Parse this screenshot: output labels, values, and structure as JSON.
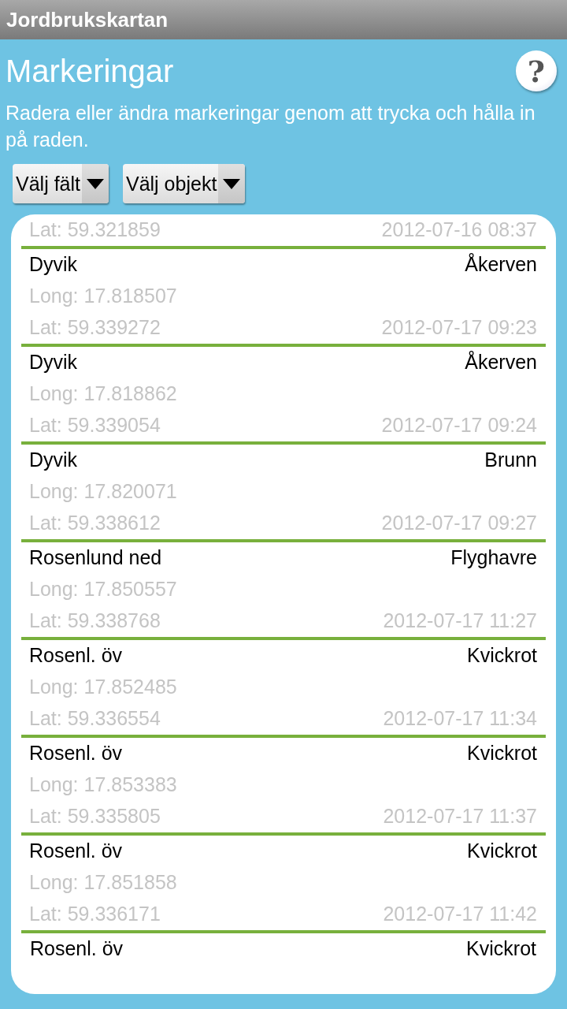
{
  "app_bar": {
    "title": "Jordbrukskartan"
  },
  "header": {
    "title": "Markeringar",
    "help": "?",
    "description": "Radera eller ändra markeringar genom att trycka och hålla in på raden."
  },
  "filters": [
    {
      "label": "Välj fält"
    },
    {
      "label": "Välj objekt"
    }
  ],
  "markings": [
    {
      "lat": "Lat: 59.321859",
      "timestamp": "2012-07-16 08:37"
    },
    {
      "field": "Dyvik",
      "object": "Åkerven",
      "long": "Long: 17.818507",
      "lat": "Lat: 59.339272",
      "timestamp": "2012-07-17 09:23"
    },
    {
      "field": "Dyvik",
      "object": "Åkerven",
      "long": "Long: 17.818862",
      "lat": "Lat: 59.339054",
      "timestamp": "2012-07-17 09:24"
    },
    {
      "field": "Dyvik",
      "object": "Brunn",
      "long": "Long: 17.820071",
      "lat": "Lat: 59.338612",
      "timestamp": "2012-07-17 09:27"
    },
    {
      "field": "Rosenlund ned",
      "object": "Flyghavre",
      "long": "Long: 17.850557",
      "lat": "Lat: 59.338768",
      "timestamp": "2012-07-17 11:27"
    },
    {
      "field": "Rosenl. öv",
      "object": "Kvickrot",
      "long": "Long: 17.852485",
      "lat": "Lat: 59.336554",
      "timestamp": "2012-07-17 11:34"
    },
    {
      "field": "Rosenl. öv",
      "object": "Kvickrot",
      "long": "Long: 17.853383",
      "lat": "Lat: 59.335805",
      "timestamp": "2012-07-17 11:37"
    },
    {
      "field": "Rosenl. öv",
      "object": "Kvickrot",
      "long": "Long: 17.851858",
      "lat": "Lat: 59.336171",
      "timestamp": "2012-07-17 11:42"
    },
    {
      "field": "Rosenl. öv",
      "object": "Kvickrot"
    }
  ]
}
